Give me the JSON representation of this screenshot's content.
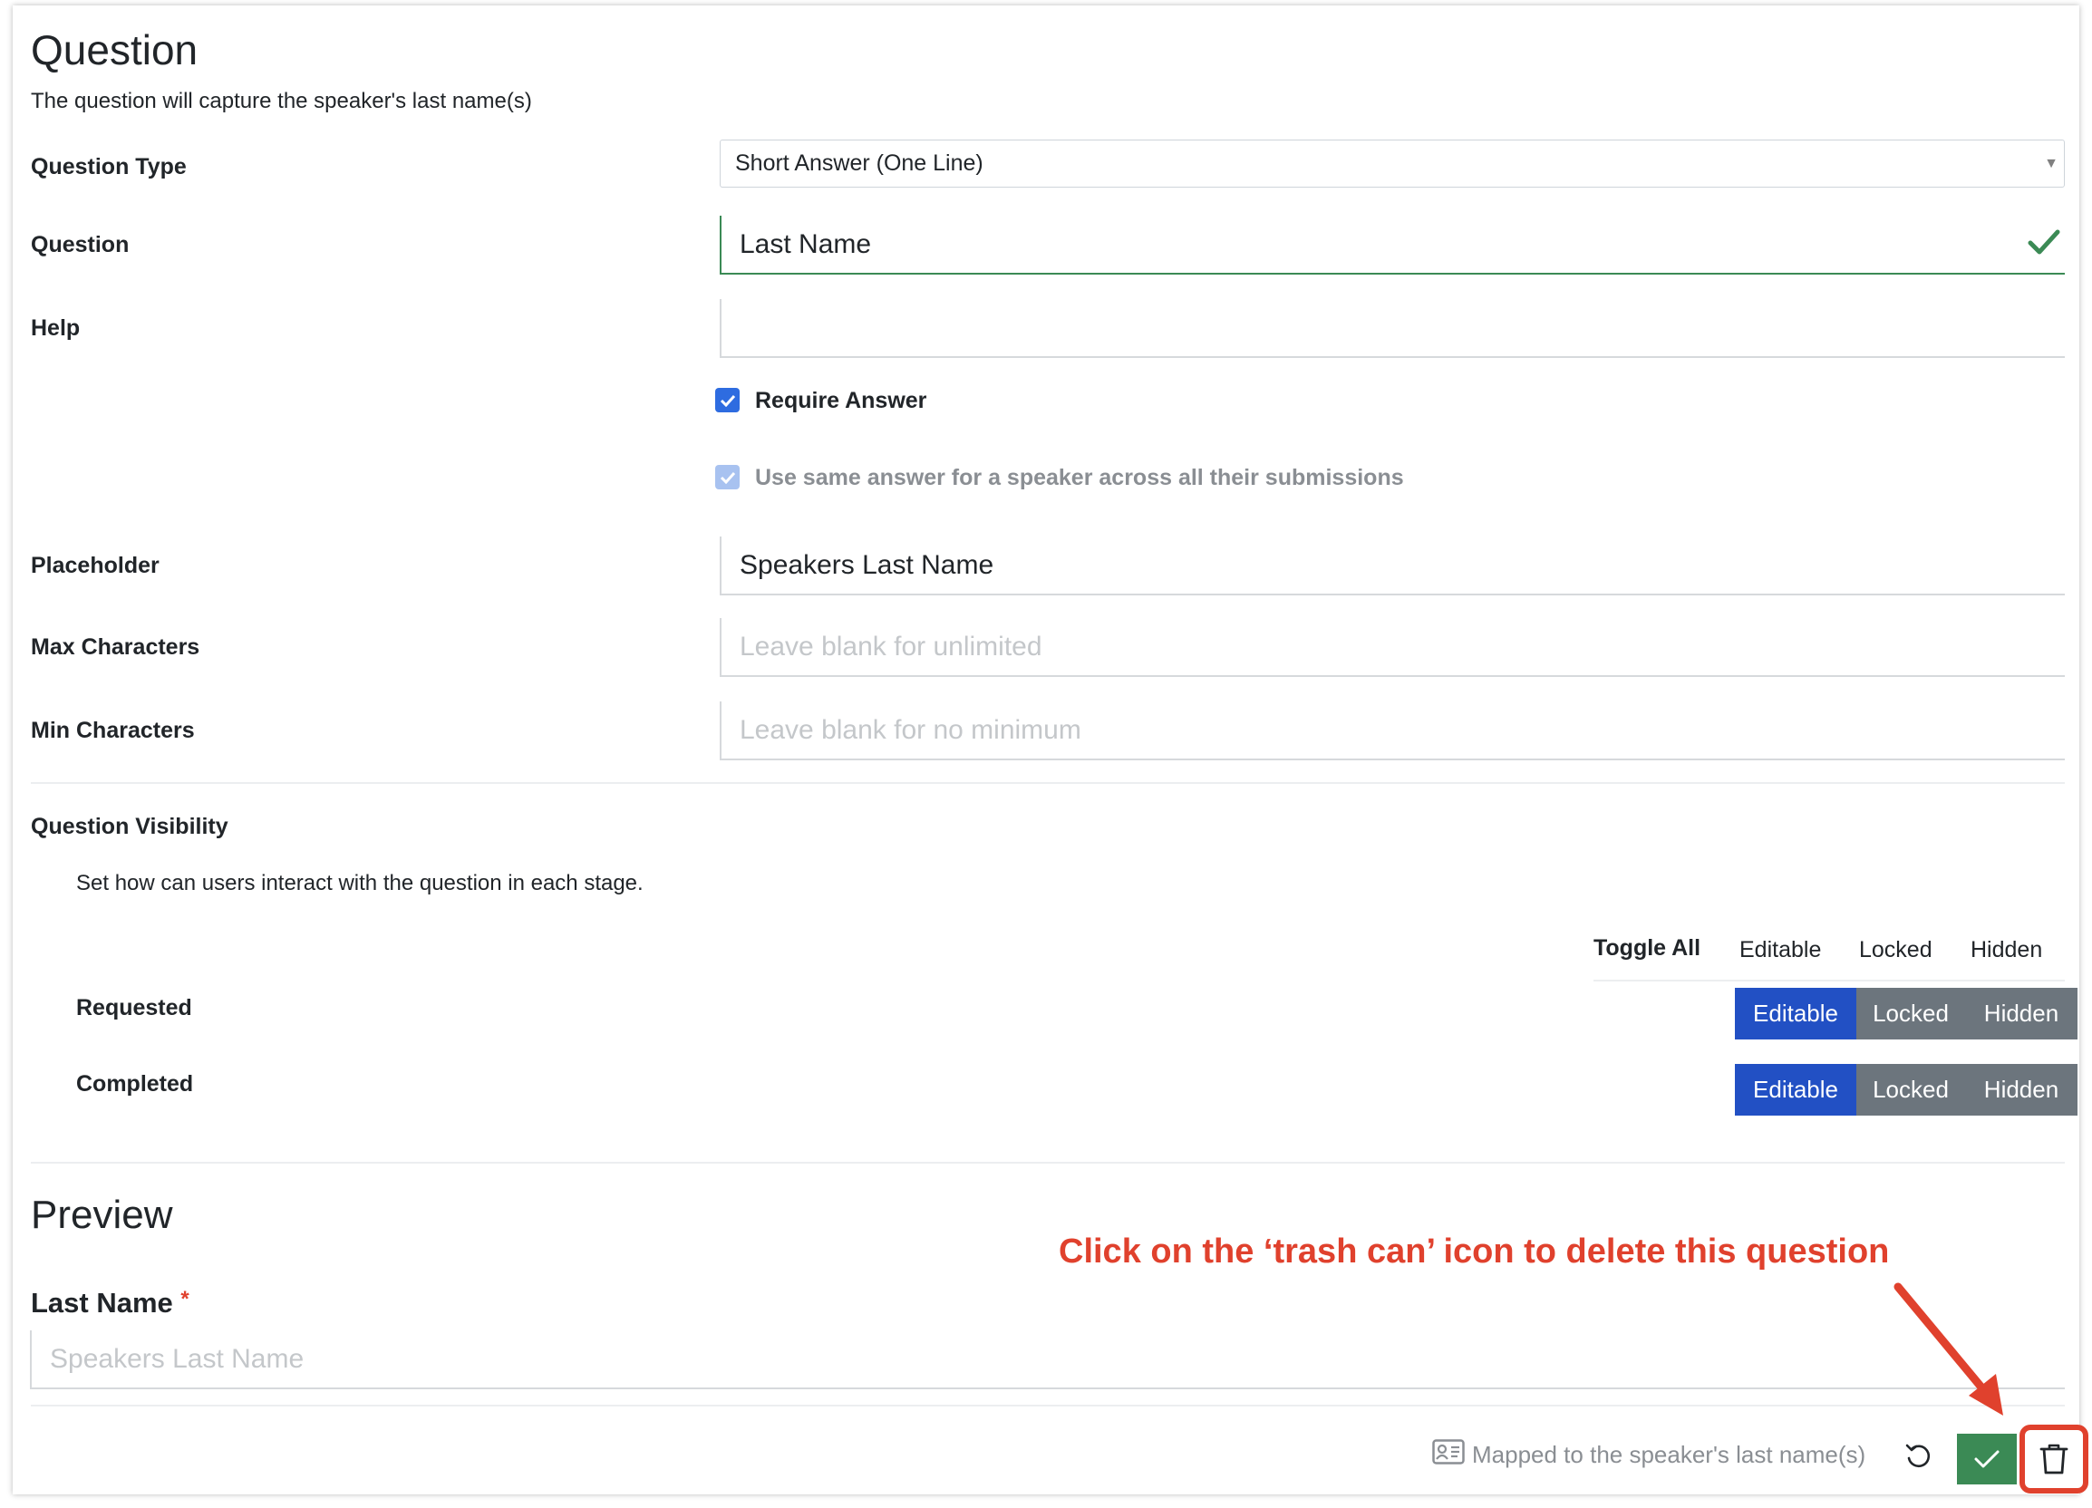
{
  "header": {
    "title": "Question",
    "description": "The question will capture the speaker's last name(s)"
  },
  "form": {
    "question_type": {
      "label": "Question Type",
      "value": "Short Answer (One Line)"
    },
    "question": {
      "label": "Question",
      "value": "Last Name"
    },
    "help": {
      "label": "Help",
      "value": ""
    },
    "require_answer": {
      "label": "Require Answer",
      "checked": true
    },
    "same_answer": {
      "label": "Use same answer for a speaker across all their submissions",
      "checked": true,
      "disabled": true
    },
    "placeholder": {
      "label": "Placeholder",
      "value": "Speakers Last Name"
    },
    "max_chars": {
      "label": "Max Characters",
      "placeholder": "Leave blank for unlimited"
    },
    "min_chars": {
      "label": "Min Characters",
      "placeholder": "Leave blank for no minimum"
    }
  },
  "visibility": {
    "title": "Question Visibility",
    "description": "Set how can users interact with the question in each stage.",
    "headers": {
      "toggle_all": "Toggle All",
      "editable": "Editable",
      "locked": "Locked",
      "hidden": "Hidden"
    },
    "rows": [
      {
        "stage": "Requested",
        "options": [
          "Editable",
          "Locked",
          "Hidden"
        ],
        "selected": "Editable"
      },
      {
        "stage": "Completed",
        "options": [
          "Editable",
          "Locked",
          "Hidden"
        ],
        "selected": "Editable"
      }
    ]
  },
  "preview": {
    "title": "Preview",
    "field_label": "Last Name",
    "required_marker": "*",
    "placeholder": "Speakers Last Name"
  },
  "annotation": {
    "text": "Click on the ‘trash can’ icon to delete this question"
  },
  "footer": {
    "mapping_text": "Mapped to the speaker's last name(s)",
    "icons": [
      "contact-card-icon",
      "undo-icon",
      "check-icon",
      "trash-icon"
    ]
  },
  "colors": {
    "primary": "#2250c4",
    "secondary": "#6c757d",
    "success": "#3b8a55",
    "annotation": "#e0412d"
  }
}
